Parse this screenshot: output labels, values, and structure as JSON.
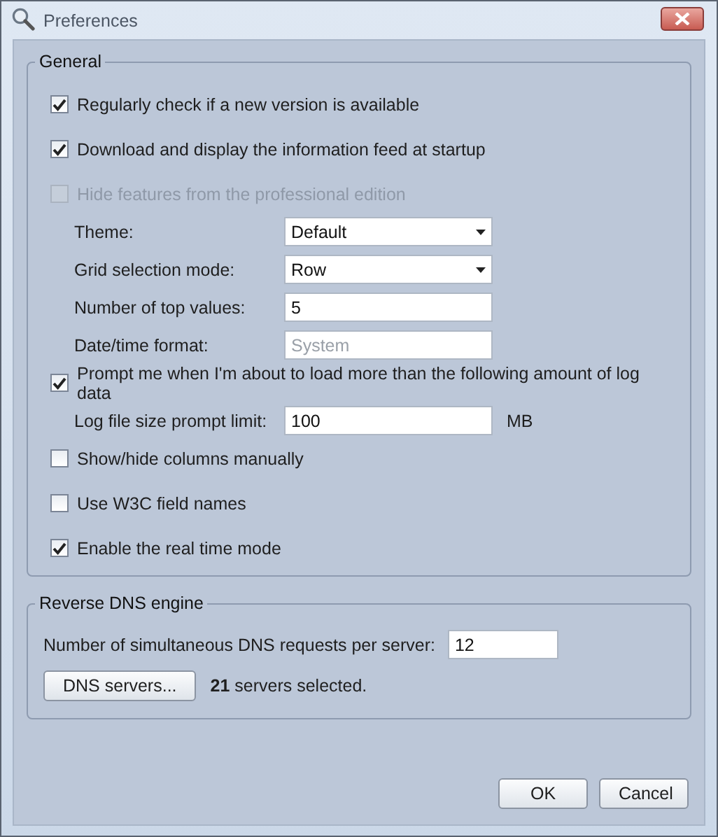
{
  "window": {
    "title": "Preferences"
  },
  "general": {
    "title": "General",
    "items": [
      {
        "kind": "checkbox",
        "label": "Regularly check if a new version is available",
        "checked": true,
        "disabled": false
      },
      {
        "kind": "checkbox",
        "label": "Download and display the information feed at startup",
        "checked": true,
        "disabled": false
      },
      {
        "kind": "checkbox",
        "label": "Hide features from the professional edition",
        "checked": false,
        "disabled": true
      },
      {
        "kind": "dropdown",
        "label": "Theme:",
        "value": "Default"
      },
      {
        "kind": "dropdown",
        "label": "Grid selection mode:",
        "value": "Row"
      },
      {
        "kind": "field",
        "label": "Number of top values:",
        "value": "5"
      },
      {
        "kind": "field",
        "label": "Date/time format:",
        "placeholder": "System"
      },
      {
        "kind": "checkbox",
        "label": "Prompt me when I'm about to load more than the following amount of log data",
        "checked": true,
        "disabled": false
      },
      {
        "kind": "field",
        "label": "Log file size prompt limit:",
        "value": "100",
        "unit": "MB"
      },
      {
        "kind": "checkbox",
        "label": "Show/hide columns manually",
        "checked": false,
        "disabled": false
      },
      {
        "kind": "checkbox",
        "label": "Use W3C field names",
        "checked": false,
        "disabled": false
      },
      {
        "kind": "checkbox",
        "label": "Enable the real time mode",
        "checked": true,
        "disabled": false
      }
    ]
  },
  "dns": {
    "title": "Reverse DNS engine",
    "requests_label": "Number of simultaneous DNS requests per server:",
    "requests_value": "12",
    "servers_button": "DNS servers...",
    "servers_status": "**21** servers selected."
  },
  "buttons": [
    "OK",
    "Cancel"
  ]
}
